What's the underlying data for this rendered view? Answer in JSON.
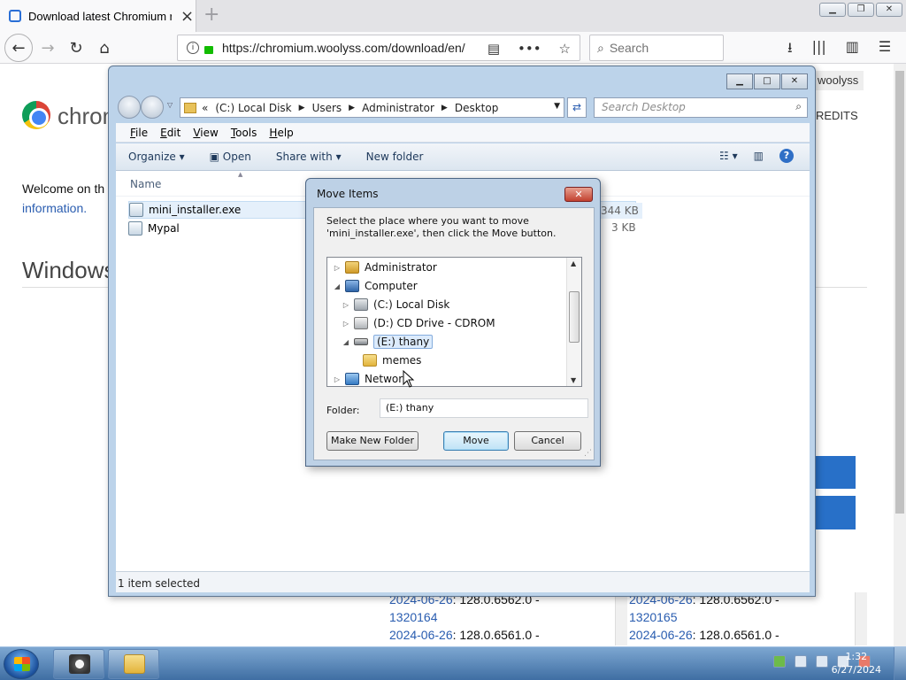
{
  "browser": {
    "tab_title": "Download latest Chromium rel",
    "url": "https://chromium.woolyss.com/download/en/",
    "search_placeholder": "Search"
  },
  "page": {
    "brand": "chrom",
    "welcome": "Welcome on th",
    "info_link": "information.",
    "section_title": "Windows",
    "site_tag": "woolyss",
    "credits": "REDITS",
    "releases_left": [
      {
        "date": "2024-06-26",
        "ver": ": 128.0.6562.0 -",
        "build": "1320164"
      },
      {
        "date": "2024-06-26",
        "ver": ": 128.0.6561.0 -",
        "build": ""
      }
    ],
    "releases_right": [
      {
        "date": "2024-06-26",
        "ver": ": 128.0.6562.0 -",
        "build": "1320165"
      },
      {
        "date": "2024-06-26",
        "ver": ": 128.0.6561.0 -",
        "build": ""
      }
    ]
  },
  "explorer": {
    "address": {
      "chevrons": "«",
      "segments": [
        "(C:) Local Disk",
        "Users",
        "Administrator",
        "Desktop"
      ]
    },
    "search_placeholder": "Search Desktop",
    "menu": [
      {
        "key": "F",
        "rest": "ile"
      },
      {
        "key": "E",
        "rest": "dit"
      },
      {
        "key": "V",
        "rest": "iew"
      },
      {
        "key": "T",
        "rest": "ools"
      },
      {
        "key": "H",
        "rest": "elp"
      }
    ],
    "toolbar": {
      "organize": "Organize",
      "open": "Open",
      "share_with": "Share with",
      "new_folder": "New folder"
    },
    "column_name": "Name",
    "files": [
      {
        "name": "mini_installer.exe",
        "size": "344 KB",
        "selected": true
      },
      {
        "name": "Mypal",
        "size": "3 KB",
        "selected": false
      }
    ],
    "status": "1 item selected"
  },
  "dialog": {
    "title": "Move Items",
    "message": "Select the place where you want to move 'mini_installer.exe', then click the Move button.",
    "tree": [
      {
        "label": "Administrator",
        "indent": 0,
        "expander": "▷",
        "icon": "user-folder-icon"
      },
      {
        "label": "Computer",
        "indent": 0,
        "expander": "◢",
        "icon": "computer-icon"
      },
      {
        "label": "(C:) Local Disk",
        "indent": 1,
        "expander": "▷",
        "icon": "hard-disk-icon"
      },
      {
        "label": "(D:) CD Drive - CDROM",
        "indent": 1,
        "expander": "▷",
        "icon": "cd-drive-icon"
      },
      {
        "label": "(E:) thany",
        "indent": 1,
        "expander": "◢",
        "icon": "usb-drive-icon",
        "selected": true
      },
      {
        "label": "memes",
        "indent": 2,
        "expander": "",
        "icon": "folder-icon"
      },
      {
        "label": "Network",
        "indent": 0,
        "expander": "▷",
        "icon": "network-icon"
      }
    ],
    "folder_label": "Folder:",
    "folder_value": "(E:) thany",
    "make_new_folder": "Make New Folder",
    "move": "Move",
    "cancel": "Cancel"
  },
  "taskbar": {
    "time": "1:32",
    "date": "6/27/2024"
  }
}
